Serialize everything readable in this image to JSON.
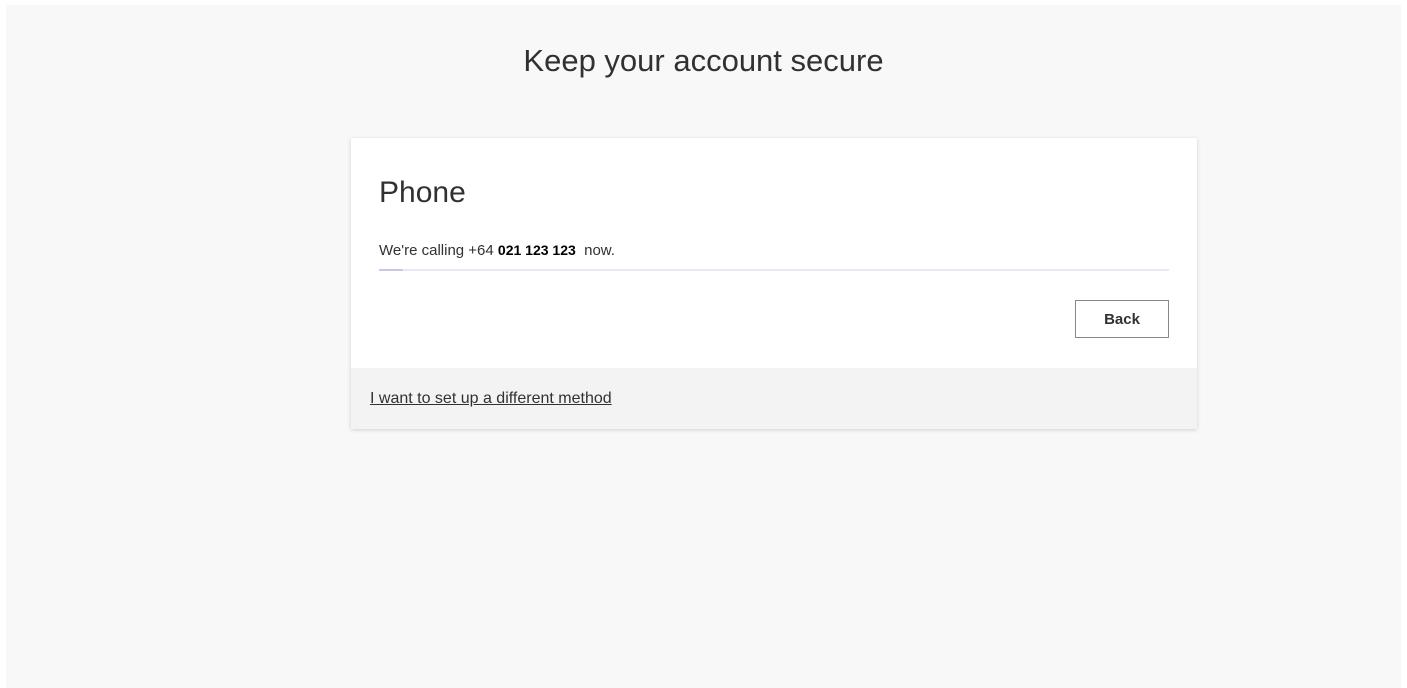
{
  "page": {
    "title": "Keep your account secure"
  },
  "card": {
    "method_title": "Phone",
    "status_prefix": "We're calling +64 ",
    "phone_number": "021 123 123",
    "status_suffix": "  now.",
    "progress": 0.03,
    "back_label": "Back"
  },
  "footer": {
    "link_label": "I want to set up a different method"
  },
  "colors": {
    "page_background": "#f8f8f8",
    "card_background": "#ffffff",
    "footer_background": "#f3f3f3",
    "text": "#323130",
    "progress_track": "#e9e8f3",
    "progress_fill": "#c8c6e6"
  }
}
